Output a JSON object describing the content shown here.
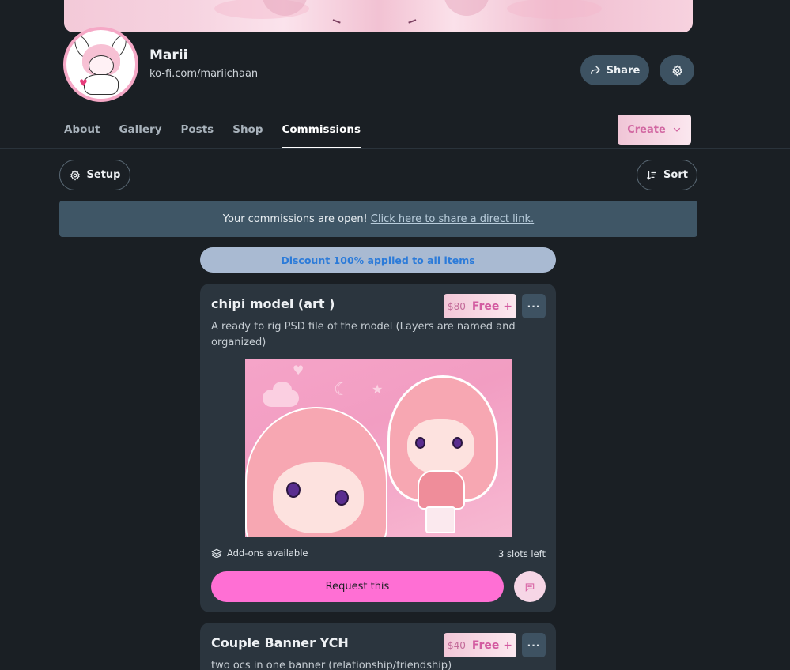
{
  "profile": {
    "name": "Marii",
    "url": "ko-fi.com/mariichaan"
  },
  "actions": {
    "share_label": "Share",
    "create_label": "Create"
  },
  "tabs": [
    {
      "label": "About"
    },
    {
      "label": "Gallery"
    },
    {
      "label": "Posts"
    },
    {
      "label": "Shop"
    },
    {
      "label": "Commissions",
      "active": true
    }
  ],
  "toolbar": {
    "setup_label": "Setup",
    "sort_label": "Sort"
  },
  "notice": {
    "text": "Your commissions are open!",
    "link": "Click here to share a direct link."
  },
  "discount": {
    "text": "Discount 100% applied to all items"
  },
  "commissions": [
    {
      "title": "chipi model (art )",
      "old_price": "$80",
      "new_price": "Free +",
      "more": "···",
      "description": "A ready to rig PSD file of the model (Layers are named and organized)",
      "addons": "Add-ons available",
      "slots": "3 slots left",
      "request_label": "Request this"
    },
    {
      "title": "Couple Banner YCH",
      "old_price": "$40",
      "new_price": "Free +",
      "more": "···",
      "description": "two ocs in one banner (relationship/friendship)"
    }
  ],
  "colors": {
    "background": "#1a1f24",
    "card": "#2b353e",
    "accent_pink": "#ff6fd4",
    "price_text": "#d35aa0",
    "discount_text": "#2c7bd9"
  },
  "icons": [
    "share-icon",
    "gear-icon",
    "chevron-down-icon",
    "sort-icon",
    "layers-icon",
    "chat-icon",
    "more-dots-icon"
  ]
}
